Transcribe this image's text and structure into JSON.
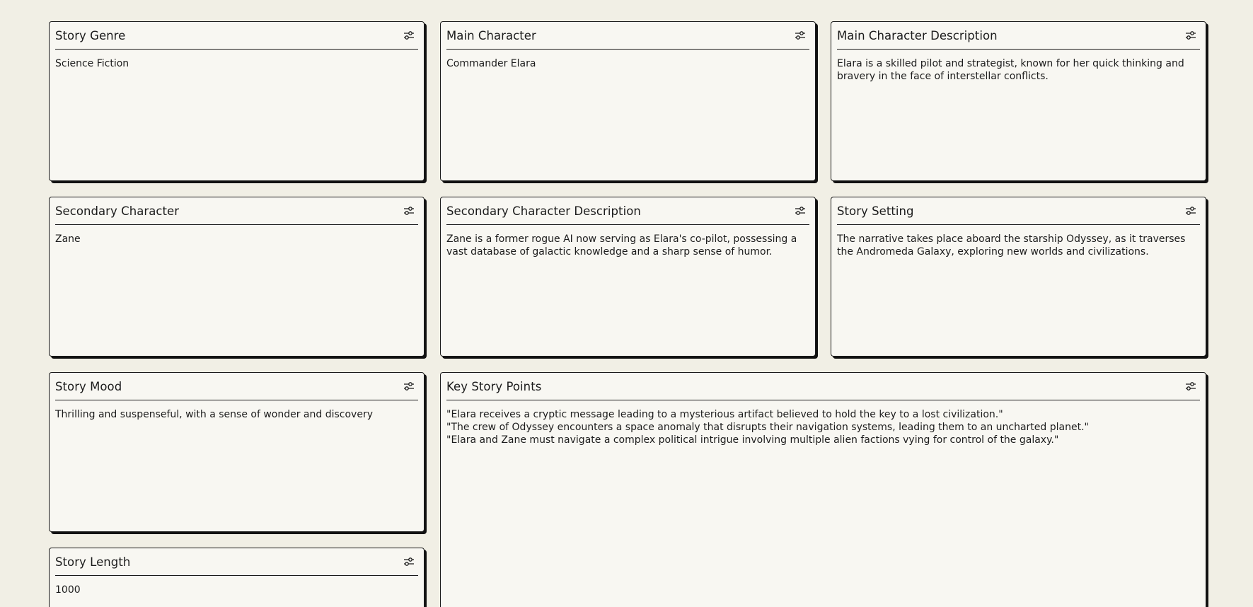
{
  "cards": [
    {
      "title": "Story Genre",
      "icon": "sliders-icon",
      "value": "Science Fiction"
    },
    {
      "title": "Main Character",
      "icon": "sliders-icon",
      "value": "Commander Elara"
    },
    {
      "title": "Main Character Description",
      "icon": "sliders-icon",
      "value": "Elara is a skilled pilot and strategist, known for her quick thinking and bravery in the face of interstellar conflicts."
    },
    {
      "title": "Secondary Character",
      "icon": "sliders-icon",
      "value": "Zane"
    },
    {
      "title": "Secondary Character Description",
      "icon": "sliders-icon",
      "value": "Zane is a former rogue AI now serving as Elara's co-pilot, possessing a vast database of galactic knowledge and a sharp sense of humor."
    },
    {
      "title": "Story Setting",
      "icon": "sliders-icon",
      "value": "The narrative takes place aboard the starship Odyssey, as it traverses the Andromeda Galaxy, exploring new worlds and civilizations."
    },
    {
      "title": "Story Mood",
      "icon": "sliders-icon",
      "value": "Thrilling and suspenseful, with a sense of wonder and discovery"
    },
    {
      "title": "Key Story Points",
      "icon": "sliders-icon",
      "value": "\"Elara receives a cryptic message leading to a mysterious artifact believed to hold the key to a lost civilization.\"\n\"The crew of Odyssey encounters a space anomaly that disrupts their navigation systems, leading them to an uncharted planet.\"\n\"Elara and Zane must navigate a complex political intrigue involving multiple alien factions vying for control of the galaxy.\""
    },
    {
      "title": "Story Length",
      "icon": "sliders-icon",
      "value": "1000"
    }
  ],
  "colors": {
    "background": "#f1efe5",
    "card": "#f8f7f2",
    "border": "#1a1a1a",
    "text": "#1c1c1c"
  }
}
